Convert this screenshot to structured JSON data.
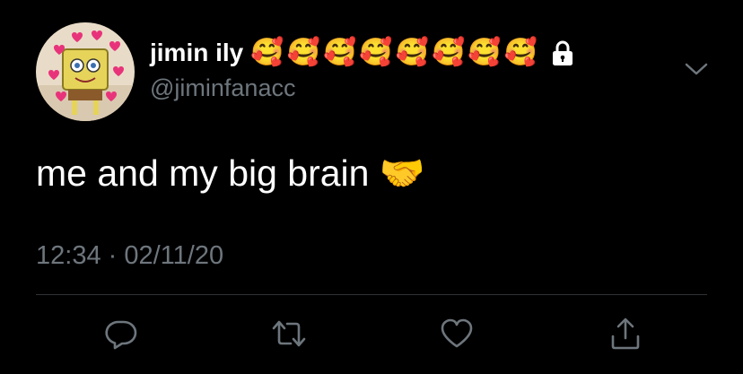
{
  "tweet": {
    "display_name": "jimin ily",
    "name_emojis": "🥰🥰🥰🥰🥰🥰🥰🥰",
    "handle": "@jiminfanacc",
    "text": "me and my big brain 🤝",
    "timestamp": "12:34 · 02/11/20"
  },
  "icons": {
    "lock": "lock-icon",
    "more": "chevron-down-icon",
    "reply": "comment-icon",
    "retweet": "retweet-icon",
    "like": "heart-icon",
    "share": "share-icon"
  },
  "colors": {
    "background": "#000000",
    "text": "#ffffff",
    "secondary_text": "#6e767d",
    "divider": "#2f3336"
  }
}
